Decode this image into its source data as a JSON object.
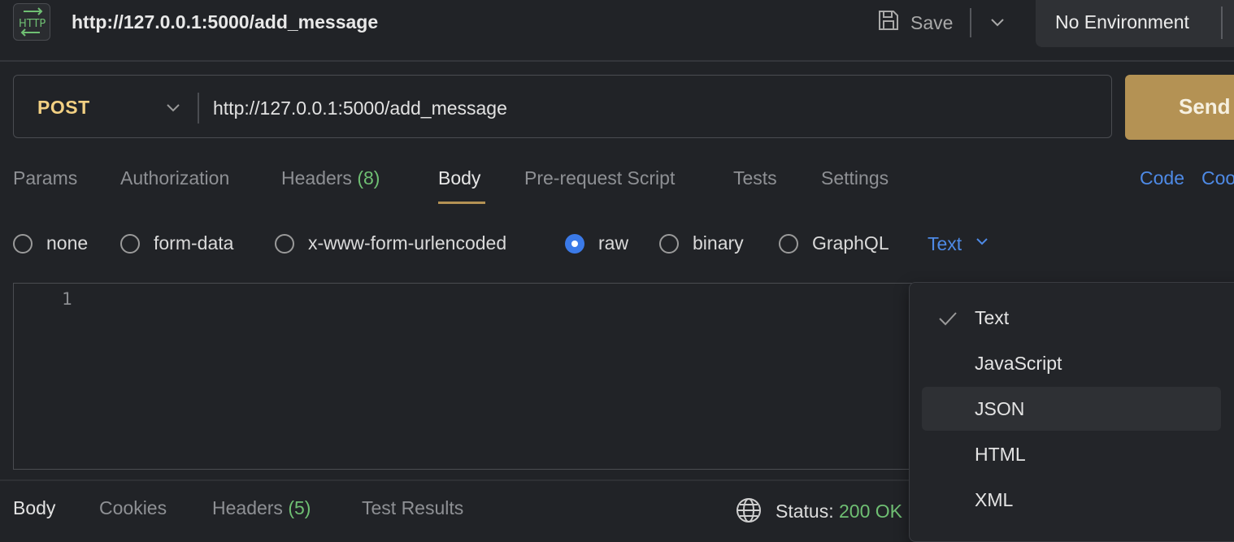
{
  "header": {
    "app_icon_text": "HTTP",
    "request_title": "http://127.0.0.1:5000/add_message",
    "save_label": "Save",
    "environment": "No Environment"
  },
  "request": {
    "method": "POST",
    "url": "http://127.0.0.1:5000/add_message",
    "send_label": "Send"
  },
  "tabs": [
    {
      "label": "Params"
    },
    {
      "label": "Authorization"
    },
    {
      "label": "Headers",
      "count": "(8)"
    },
    {
      "label": "Body"
    },
    {
      "label": "Pre-request Script"
    },
    {
      "label": "Tests"
    },
    {
      "label": "Settings"
    }
  ],
  "active_tab": "Body",
  "code_links": [
    "Code",
    "Coo"
  ],
  "body_types": [
    {
      "label": "none",
      "selected": false
    },
    {
      "label": "form-data",
      "selected": false
    },
    {
      "label": "x-www-form-urlencoded",
      "selected": false
    },
    {
      "label": "raw",
      "selected": true
    },
    {
      "label": "binary",
      "selected": false
    },
    {
      "label": "GraphQL",
      "selected": false
    }
  ],
  "language_select": {
    "value": "Text"
  },
  "editor": {
    "line_numbers": [
      "1"
    ]
  },
  "dropdown": {
    "items": [
      {
        "label": "Text",
        "checked": true
      },
      {
        "label": "JavaScript",
        "checked": false
      },
      {
        "label": "JSON",
        "checked": false,
        "hovered": true
      },
      {
        "label": "HTML",
        "checked": false
      },
      {
        "label": "XML",
        "checked": false
      }
    ]
  },
  "response": {
    "tabs": [
      {
        "label": "Body"
      },
      {
        "label": "Cookies"
      },
      {
        "label": "Headers",
        "count": "(5)"
      },
      {
        "label": "Test Results"
      }
    ],
    "status_label": "Status:",
    "status_value": "200 OK"
  },
  "colors": {
    "background": "#212327",
    "method": "#f2d083",
    "send_button": "#b49254",
    "link_blue": "#4e8ae6",
    "count_green": "#6fbf73",
    "radio_selected": "#3b7ae8"
  }
}
